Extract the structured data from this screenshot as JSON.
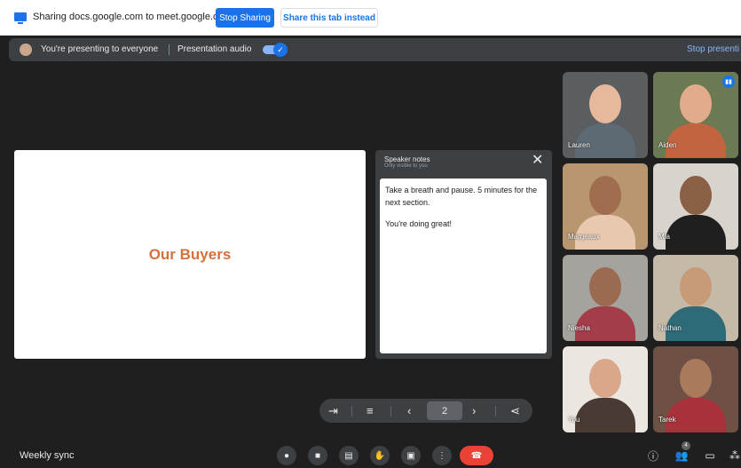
{
  "share_bar": {
    "text": "Sharing docs.google.com to meet.google.com",
    "stop_sharing": "Stop Sharing",
    "share_tab": "Share this tab instead"
  },
  "presenting_bar": {
    "text": "You're presenting to everyone",
    "audio_label": "Presentation audio",
    "audio_on": true,
    "stop_label": "Stop presenti"
  },
  "slide": {
    "title": "Our Buyers"
  },
  "speaker_notes": {
    "title": "Speaker notes",
    "subtitle": "Only visible to you",
    "paragraphs": [
      "Take a breath and pause. 5 minutes for the next section.",
      "You're doing great!"
    ]
  },
  "participants": [
    {
      "name": "Lauren"
    },
    {
      "name": "Aiden"
    },
    {
      "name": "Margeaux"
    },
    {
      "name": "Mia"
    },
    {
      "name": "Niesha"
    },
    {
      "name": "Nathan"
    },
    {
      "name": "You"
    },
    {
      "name": "Tarek"
    }
  ],
  "pager": {
    "page": "2"
  },
  "meeting": {
    "title": "Weekly sync",
    "people_count": "4"
  },
  "colors": {
    "accent": "#1a73e8",
    "end_call": "#ea4335",
    "slide_title": "#d5713a"
  }
}
